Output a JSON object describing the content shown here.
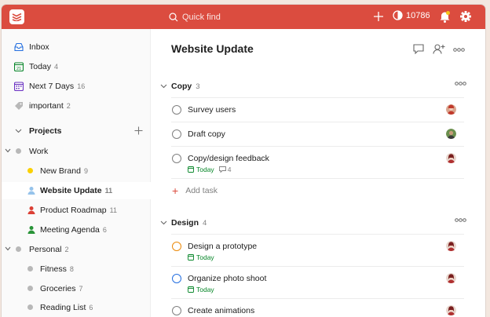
{
  "topbar": {
    "search_placeholder": "Quick find",
    "karma": "10786"
  },
  "sidebar": {
    "items": [
      {
        "label": "Inbox",
        "count": ""
      },
      {
        "label": "Today",
        "count": "4"
      },
      {
        "label": "Next 7 Days",
        "count": "16"
      },
      {
        "label": "important",
        "count": "2"
      }
    ],
    "projects_label": "Projects",
    "projects": [
      {
        "label": "Work",
        "count": ""
      },
      {
        "label": "New Brand",
        "count": "9"
      },
      {
        "label": "Website Update",
        "count": "11"
      },
      {
        "label": "Product Roadmap",
        "count": "11"
      },
      {
        "label": "Meeting Agenda",
        "count": "6"
      },
      {
        "label": "Personal",
        "count": "2"
      },
      {
        "label": "Fitness",
        "count": "8"
      },
      {
        "label": "Groceries",
        "count": "7"
      },
      {
        "label": "Reading List",
        "count": "6"
      }
    ]
  },
  "main": {
    "title": "Website Update",
    "sections": [
      {
        "name": "Copy",
        "count": "3",
        "tasks": [
          {
            "name": "Survey users"
          },
          {
            "name": "Draft copy"
          },
          {
            "name": "Copy/design feedback",
            "due": "Today",
            "comments": "4"
          }
        ],
        "add_label": "Add task"
      },
      {
        "name": "Design",
        "count": "4",
        "tasks": [
          {
            "name": "Design a prototype",
            "due": "Today"
          },
          {
            "name": "Organize photo shoot",
            "due": "Today"
          },
          {
            "name": "Create animations"
          }
        ]
      }
    ]
  },
  "colors": {
    "brand": "#db4c3f",
    "today_green": "#058527",
    "priority_orange": "#eb8909",
    "priority_blue": "#246fe0"
  }
}
